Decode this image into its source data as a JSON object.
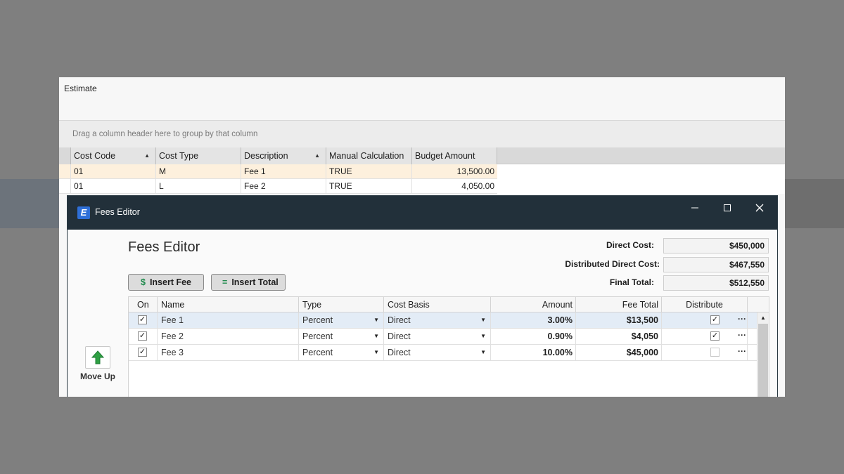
{
  "estimate": {
    "title": "Estimate",
    "group_hint": "Drag a column header here to group by that column",
    "columns": [
      "Cost Code",
      "Cost Type",
      "Description",
      "Manual Calculation",
      "Budget Amount"
    ],
    "rows": [
      [
        "01",
        "M",
        "Fee 1",
        "TRUE",
        "13,500.00"
      ],
      [
        "01",
        "L",
        "Fee 2",
        "TRUE",
        "4,050.00"
      ]
    ]
  },
  "dialog": {
    "window_title": "Fees Editor",
    "heading": "Fees Editor",
    "logo_letter": "E",
    "summary": {
      "direct_cost_label": "Direct Cost:",
      "direct_cost_value": "$450,000",
      "distributed_label": "Distributed Direct Cost:",
      "distributed_value": "$467,550",
      "final_total_label": "Final Total:",
      "final_total_value": "$512,550"
    },
    "toolbar": {
      "insert_fee_icon": "$",
      "insert_fee_label": "Insert Fee",
      "insert_total_icon": "=",
      "insert_total_label": "Insert Total"
    },
    "move_up_label": "Move Up",
    "fee_columns": [
      "On",
      "Name",
      "Type",
      "Cost Basis",
      "Amount",
      "Fee Total",
      "Distribute"
    ],
    "fees": [
      {
        "on": true,
        "name": "Fee 1",
        "type": "Percent",
        "cost_basis": "Direct",
        "amount": "3.00%",
        "fee_total": "$13,500",
        "distribute": true
      },
      {
        "on": true,
        "name": "Fee 2",
        "type": "Percent",
        "cost_basis": "Direct",
        "amount": "0.90%",
        "fee_total": "$4,050",
        "distribute": true
      },
      {
        "on": true,
        "name": "Fee 3",
        "type": "Percent",
        "cost_basis": "Direct",
        "amount": "10.00%",
        "fee_total": "$45,000",
        "distribute": false
      }
    ],
    "more_glyph": "···",
    "check_glyph": "✓"
  },
  "colors": {
    "titlebar": "#22303a",
    "selected_row": "#fdf0dd",
    "selected_fee_row": "#e3ecf6",
    "accent_green": "#1f8a4c"
  }
}
